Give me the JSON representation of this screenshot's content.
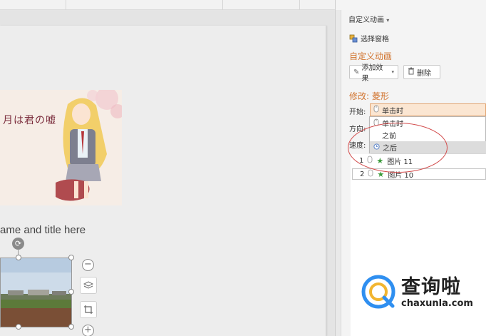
{
  "panel": {
    "title": "自定义动画",
    "selection_pane": "选择窗格",
    "section_heading": "自定义动画",
    "add_effect_label": "添加效果",
    "delete_label": "删除",
    "modify_label": "修改: 菱形",
    "start_label": "开始:",
    "direction_label": "方向:",
    "speed_label": "速度:",
    "start_value": "单击时",
    "start_options": [
      "单击时",
      "之前",
      "之后"
    ],
    "selected_option": "之后",
    "animation_list": [
      {
        "index": "1",
        "name": "图片 11"
      },
      {
        "index": "2",
        "name": "图片 10"
      }
    ]
  },
  "slide": {
    "text": "ame and title here",
    "anime_caption": "月は君の嘘"
  },
  "watermark": {
    "cn": "查询啦",
    "en": "chaxunla.com"
  },
  "colors": {
    "accent_orange": "#d1722c",
    "annotation_red": "#d24b4b",
    "selected_bg": "#fbe6d2",
    "star_green": "#3a9a3a"
  }
}
